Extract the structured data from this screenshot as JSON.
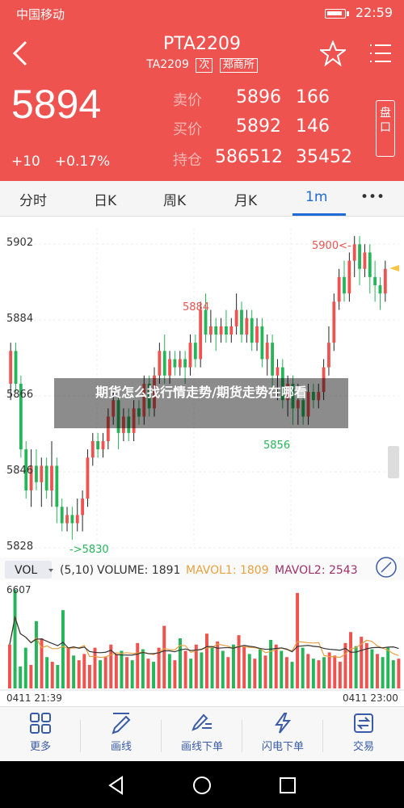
{
  "status_bar": {
    "carrier": "中国移动",
    "time": "22:59"
  },
  "header": {
    "title": "PTA2209",
    "code": "TA2209",
    "tag1": "次",
    "tag2": "郑商所",
    "price": "5894",
    "change": "+10",
    "change_pct": "+0.17%",
    "sell_label": "卖价",
    "sell_price": "5896",
    "sell_vol": "166",
    "buy_label": "买价",
    "buy_price": "5892",
    "buy_vol": "146",
    "oi_label": "持仓",
    "oi_value": "586512",
    "oi_change": "35452",
    "plate_label": "盘口"
  },
  "tabs": [
    "分时",
    "日K",
    "周K",
    "月K",
    "1m",
    "•••"
  ],
  "active_tab": "1m",
  "chart_data": {
    "type": "candlestick",
    "y_ticks": [
      "5902",
      "5884",
      "5866",
      "5846",
      "5828"
    ],
    "ylim": [
      5826,
      5904
    ],
    "annotations": {
      "high": "5900<-",
      "peak": "5884",
      "trough": "5856",
      "low": "->5830"
    },
    "candles": [
      [
        5866,
        5874,
        5862,
        5876
      ],
      [
        5874,
        5866,
        5864,
        5876
      ],
      [
        5866,
        5850,
        5848,
        5868
      ],
      [
        5850,
        5840,
        5838,
        5852
      ],
      [
        5840,
        5846,
        5836,
        5850
      ],
      [
        5846,
        5842,
        5840,
        5850
      ],
      [
        5842,
        5846,
        5836,
        5848
      ],
      [
        5846,
        5840,
        5838,
        5848
      ],
      [
        5840,
        5846,
        5836,
        5852
      ],
      [
        5846,
        5836,
        5832,
        5848
      ],
      [
        5836,
        5832,
        5830,
        5838
      ],
      [
        5832,
        5834,
        5830,
        5836
      ],
      [
        5834,
        5832,
        5828,
        5836
      ],
      [
        5832,
        5834,
        5830,
        5838
      ],
      [
        5834,
        5838,
        5830,
        5840
      ],
      [
        5838,
        5848,
        5836,
        5850
      ],
      [
        5848,
        5852,
        5846,
        5854
      ],
      [
        5852,
        5850,
        5848,
        5854
      ],
      [
        5850,
        5852,
        5848,
        5854
      ],
      [
        5852,
        5858,
        5850,
        5860
      ],
      [
        5858,
        5862,
        5856,
        5864
      ],
      [
        5862,
        5854,
        5850,
        5864
      ],
      [
        5854,
        5858,
        5852,
        5860
      ],
      [
        5858,
        5854,
        5852,
        5860
      ],
      [
        5854,
        5860,
        5852,
        5862
      ],
      [
        5860,
        5858,
        5856,
        5862
      ],
      [
        5858,
        5866,
        5856,
        5868
      ],
      [
        5866,
        5860,
        5858,
        5868
      ],
      [
        5860,
        5868,
        5858,
        5870
      ],
      [
        5868,
        5874,
        5866,
        5876
      ],
      [
        5874,
        5868,
        5866,
        5878
      ],
      [
        5868,
        5872,
        5866,
        5874
      ],
      [
        5872,
        5870,
        5868,
        5874
      ],
      [
        5870,
        5872,
        5868,
        5874
      ],
      [
        5872,
        5870,
        5866,
        5874
      ],
      [
        5870,
        5876,
        5868,
        5878
      ],
      [
        5876,
        5872,
        5870,
        5878
      ],
      [
        5872,
        5884,
        5870,
        5886
      ],
      [
        5884,
        5878,
        5876,
        5888
      ],
      [
        5878,
        5880,
        5876,
        5884
      ],
      [
        5880,
        5878,
        5874,
        5882
      ],
      [
        5878,
        5880,
        5876,
        5882
      ],
      [
        5880,
        5878,
        5876,
        5884
      ],
      [
        5878,
        5880,
        5876,
        5882
      ],
      [
        5880,
        5884,
        5878,
        5888
      ],
      [
        5884,
        5878,
        5876,
        5886
      ],
      [
        5878,
        5882,
        5876,
        5884
      ],
      [
        5882,
        5876,
        5874,
        5884
      ],
      [
        5876,
        5880,
        5874,
        5882
      ],
      [
        5880,
        5872,
        5870,
        5882
      ],
      [
        5872,
        5876,
        5868,
        5878
      ],
      [
        5876,
        5868,
        5864,
        5878
      ],
      [
        5868,
        5870,
        5862,
        5872
      ],
      [
        5870,
        5862,
        5860,
        5872
      ],
      [
        5862,
        5866,
        5858,
        5868
      ],
      [
        5866,
        5860,
        5856,
        5868
      ],
      [
        5860,
        5862,
        5856,
        5866
      ],
      [
        5862,
        5858,
        5856,
        5864
      ],
      [
        5858,
        5864,
        5856,
        5866
      ],
      [
        5864,
        5862,
        5860,
        5866
      ],
      [
        5862,
        5864,
        5860,
        5866
      ],
      [
        5864,
        5870,
        5862,
        5872
      ],
      [
        5870,
        5876,
        5868,
        5880
      ],
      [
        5876,
        5886,
        5874,
        5888
      ],
      [
        5886,
        5892,
        5884,
        5894
      ],
      [
        5892,
        5888,
        5886,
        5896
      ],
      [
        5888,
        5896,
        5886,
        5898
      ],
      [
        5896,
        5900,
        5892,
        5902
      ],
      [
        5900,
        5894,
        5890,
        5902
      ],
      [
        5894,
        5898,
        5892,
        5900
      ],
      [
        5898,
        5892,
        5888,
        5900
      ],
      [
        5892,
        5890,
        5886,
        5896
      ],
      [
        5890,
        5888,
        5884,
        5892
      ],
      [
        5888,
        5894,
        5886,
        5896
      ]
    ],
    "volume": {
      "label": "VOL",
      "params": "(5,10)",
      "volume_text": "VOLUME: 1891",
      "mavol1_text": "MAVOL1: 1809",
      "mavol2_text": "MAVOL2: 2543",
      "max_label": "6607",
      "ylim": [
        0,
        6607
      ],
      "values": [
        2800,
        6300,
        1400,
        2600,
        1500,
        4300,
        3200,
        2000,
        1700,
        1500,
        5000,
        2600,
        2100,
        1800,
        2200,
        1500,
        2600,
        1800,
        2000,
        2800,
        2200,
        2400,
        2000,
        1800,
        2900,
        2500,
        1900,
        1700,
        2600,
        4000,
        2200,
        1800,
        3200,
        2400,
        1900,
        2800,
        2300,
        3500,
        2600,
        3000,
        2400,
        2000,
        2800,
        3400,
        2700,
        2200,
        1900,
        2500,
        2100,
        3100,
        2800,
        2400,
        2000,
        1700,
        6100,
        2600,
        2200,
        1900,
        1800,
        2000,
        2300,
        2100,
        1700,
        2900,
        3600,
        2700,
        3300,
        2900,
        2500,
        2200,
        2000,
        2600,
        1800,
        1900
      ]
    },
    "time_start": "0411 21:39",
    "time_end": "0411 23:00"
  },
  "overlay_title": "期货怎么找行情走势/期货走势在哪看",
  "toolbar": [
    "更多",
    "画线",
    "画线下单",
    "闪电下单",
    "交易"
  ],
  "colors": {
    "up": "#ef5350",
    "down": "#26b559",
    "accent": "#1e6bd6",
    "ma1": "#e8a040",
    "ma2": "#333333"
  }
}
